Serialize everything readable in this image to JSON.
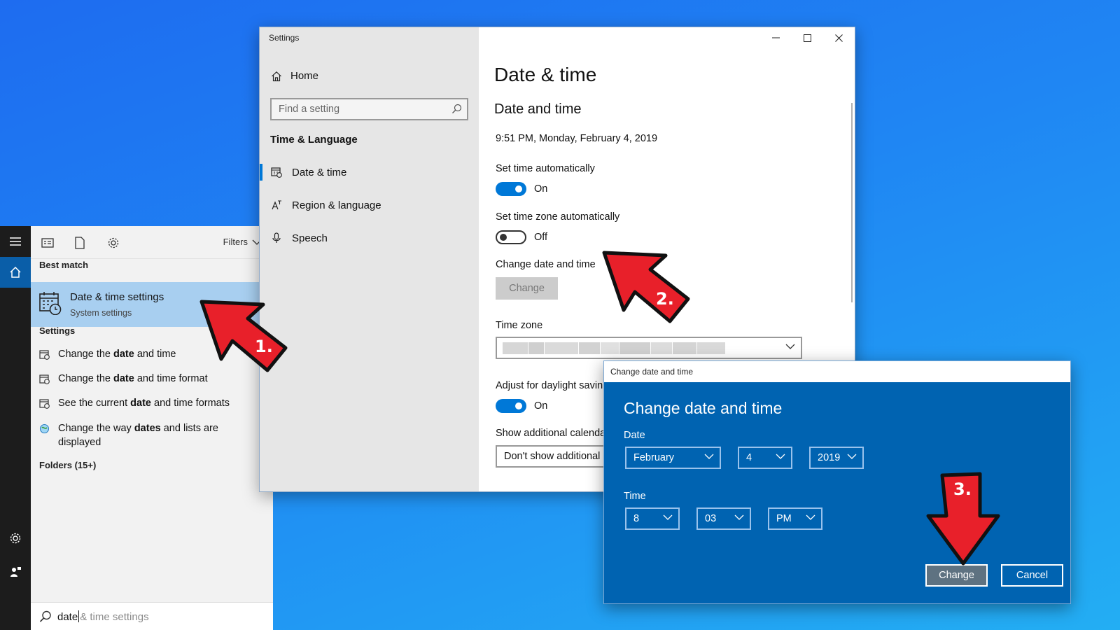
{
  "start_menu": {
    "filters_label": "Filters",
    "best_match_header": "Best match",
    "best_match": {
      "title": "Date & time settings",
      "subtitle": "System settings"
    },
    "settings_header": "Settings",
    "results": [
      {
        "before": "Change the ",
        "bold": "date",
        "after": " and time",
        "line2": ""
      },
      {
        "before": "Change the ",
        "bold": "date",
        "after": " and time format",
        "line2": ""
      },
      {
        "before": "See the current ",
        "bold": "date",
        "after": " and time formats",
        "line2": ""
      },
      {
        "before": "Change the way ",
        "bold": "dates",
        "after": " and lists are",
        "line2": "displayed"
      }
    ],
    "folders_header": "Folders (15+)",
    "search": {
      "typed": "date",
      "suggestion": "& time settings"
    }
  },
  "settings": {
    "window_title": "Settings",
    "home_label": "Home",
    "search_placeholder": "Find a setting",
    "section_title": "Time & Language",
    "nav": [
      "Date & time",
      "Region & language",
      "Speech"
    ],
    "page_title": "Date & time",
    "subsection_title": "Date and time",
    "current_datetime": "9:51 PM, Monday, February 4, 2019",
    "set_time_auto": {
      "label": "Set time automatically",
      "state": "On"
    },
    "set_tz_auto": {
      "label": "Set time zone automatically",
      "state": "Off"
    },
    "change_label": "Change date and time",
    "change_button": "Change",
    "timezone_label": "Time zone",
    "dst": {
      "label": "Adjust for daylight savin",
      "state": "On"
    },
    "calendars": {
      "label": "Show additional calenda",
      "value": "Don't show additional"
    }
  },
  "dialog": {
    "window_title": "Change date and time",
    "heading": "Change date and time",
    "date_label": "Date",
    "month": "February",
    "day": "4",
    "year": "2019",
    "time_label": "Time",
    "hour": "8",
    "minute": "03",
    "ampm": "PM",
    "change_button": "Change",
    "cancel_button": "Cancel"
  },
  "annotations": {
    "step1": "1.",
    "step2": "2.",
    "step3": "3."
  },
  "colors": {
    "accent": "#0078d7",
    "dialog_bg": "#0063b1",
    "arrow_red": "#e8202a",
    "highlight": "#a8cff0"
  }
}
